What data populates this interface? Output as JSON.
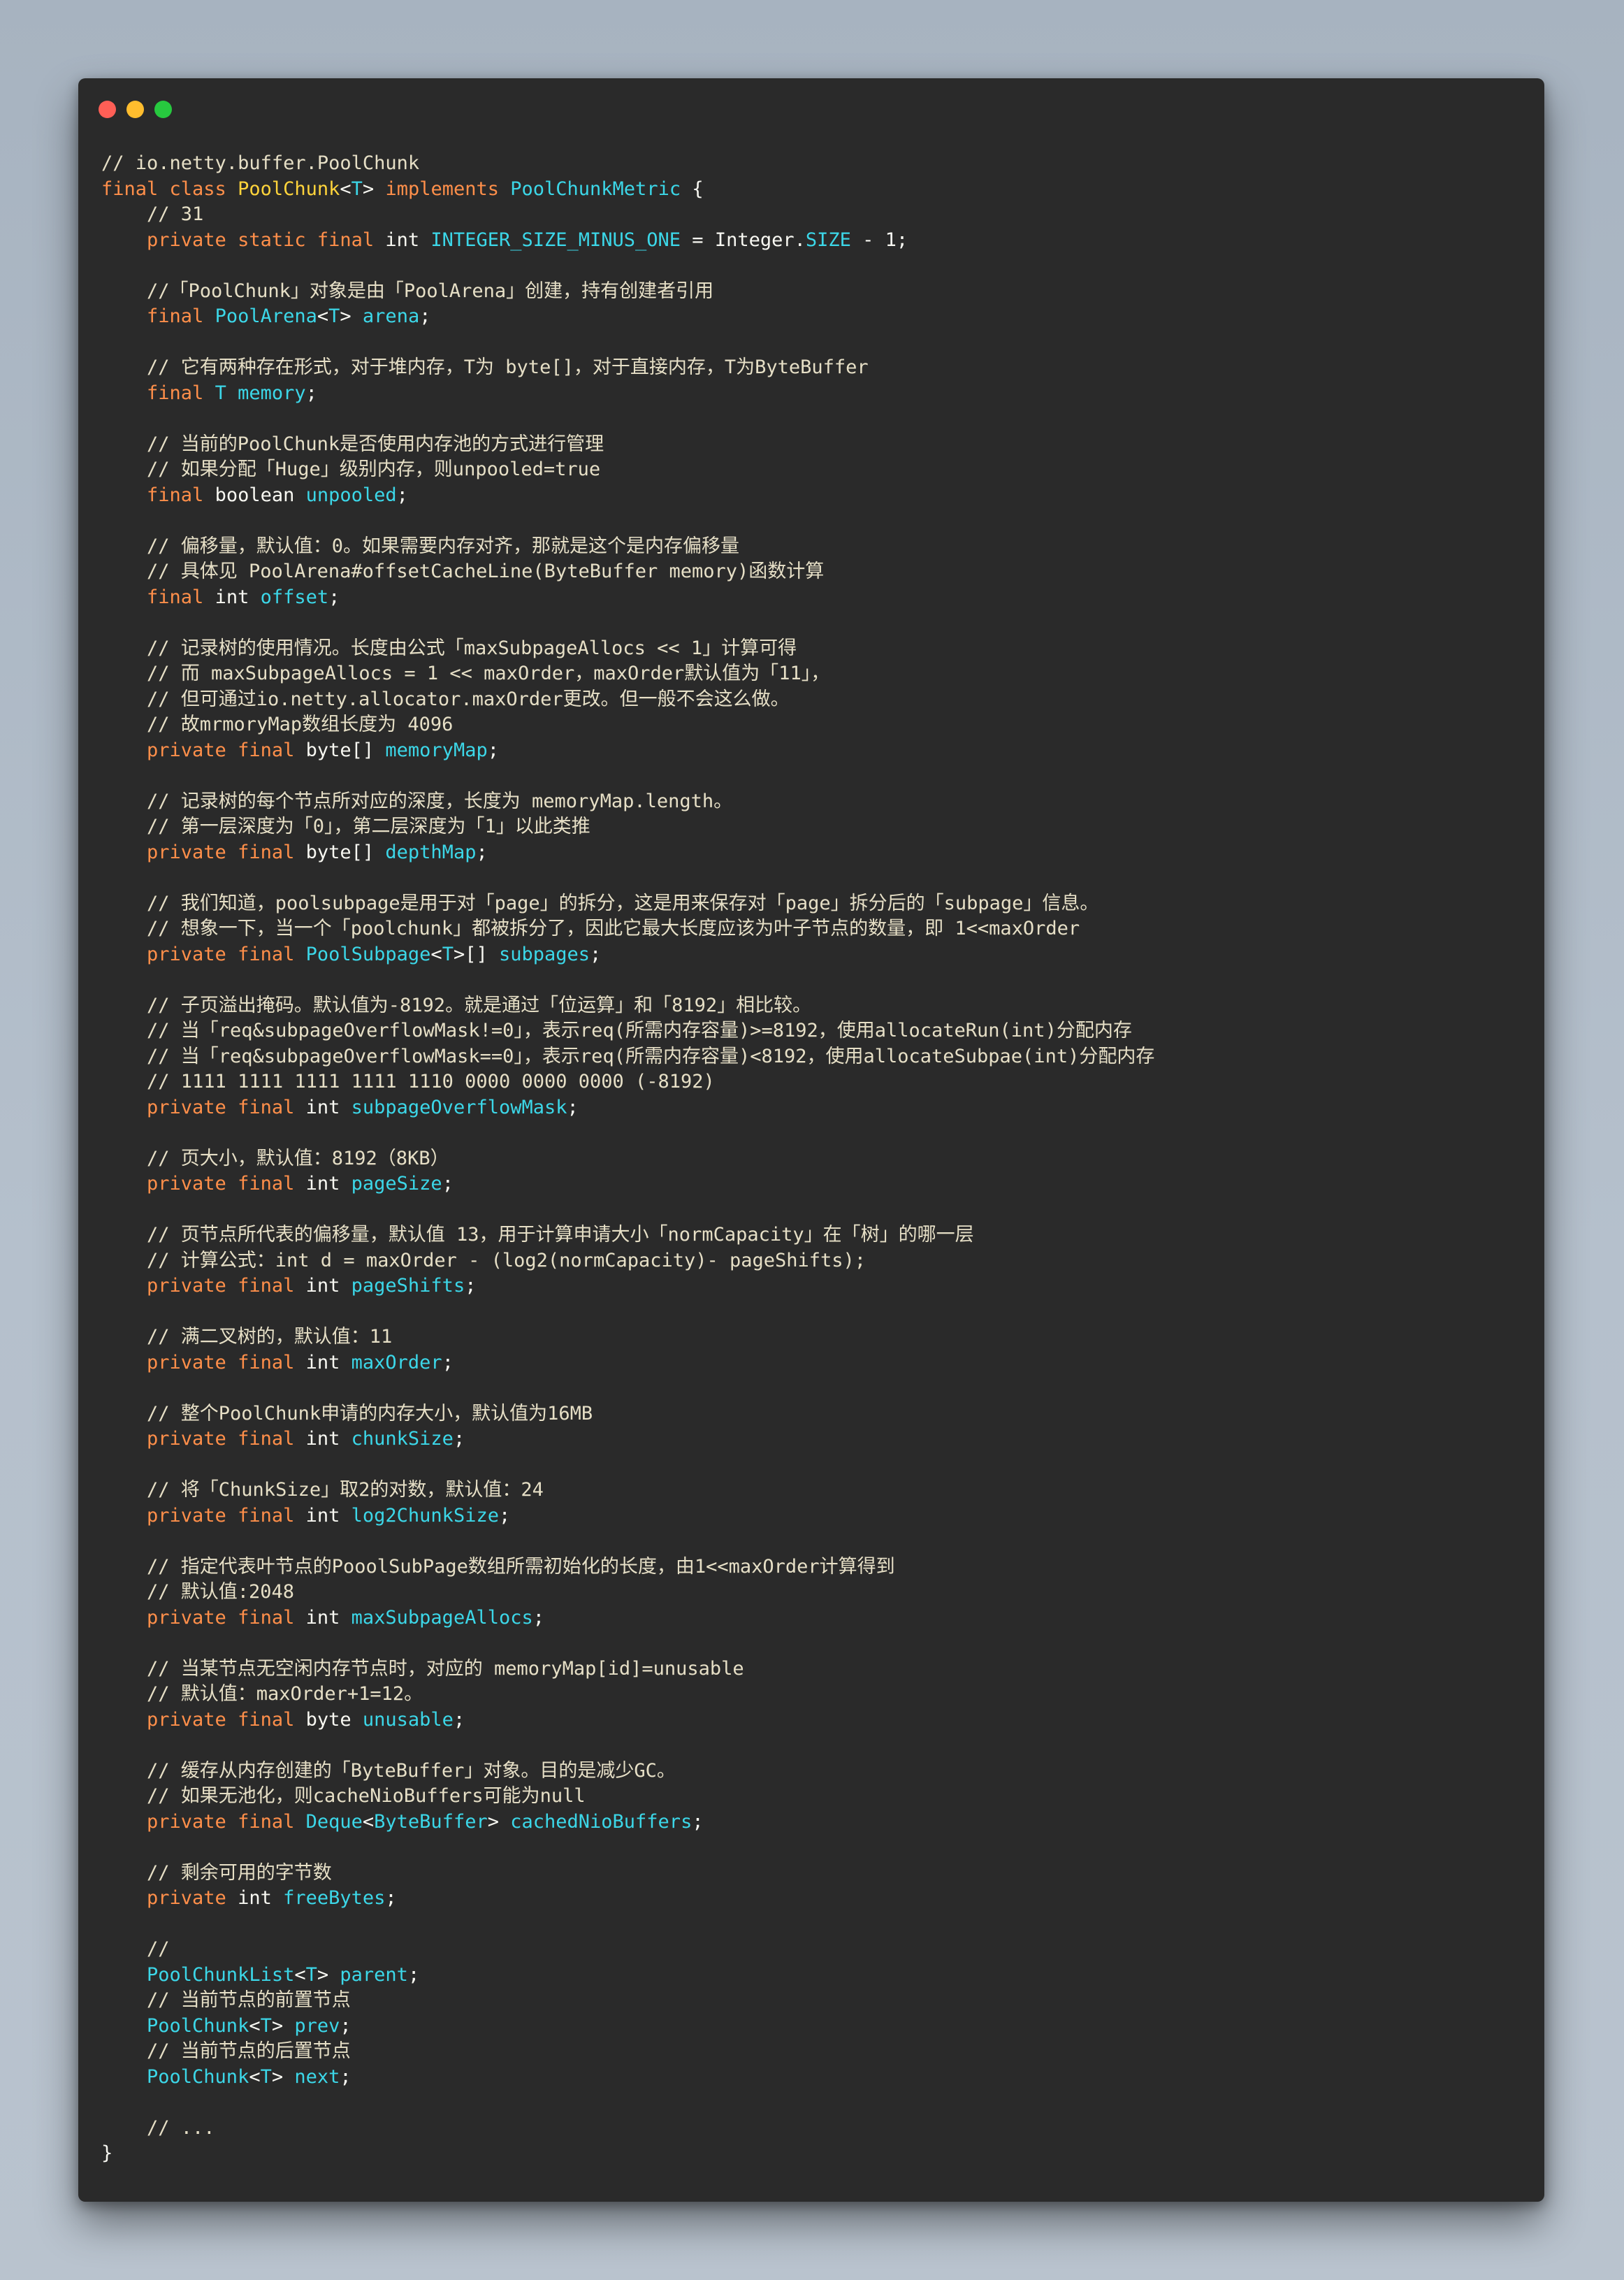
{
  "window": {
    "controls": [
      "close",
      "minimize",
      "zoom"
    ]
  },
  "code_lines": [
    [
      [
        "comment",
        "// io.netty.buffer.PoolChunk"
      ]
    ],
    [
      [
        "keyword",
        "final class "
      ],
      [
        "classname",
        "PoolChunk"
      ],
      [
        "punct",
        "<"
      ],
      [
        "type",
        "T"
      ],
      [
        "punct",
        "> "
      ],
      [
        "keyword",
        "implements "
      ],
      [
        "type",
        "PoolChunkMetric"
      ],
      [
        "punct",
        " {"
      ]
    ],
    [
      [
        "comment",
        "    // 31"
      ]
    ],
    [
      [
        "keyword",
        "    private static final "
      ],
      [
        "plain",
        "int "
      ],
      [
        "field",
        "INTEGER_SIZE_MINUS_ONE"
      ],
      [
        "plain",
        " = Integer."
      ],
      [
        "field",
        "SIZE"
      ],
      [
        "plain",
        " - 1;"
      ]
    ],
    [],
    [
      [
        "comment",
        "    //「PoolChunk」对象是由「PoolArena」创建，持有创建者引用"
      ]
    ],
    [
      [
        "keyword",
        "    final "
      ],
      [
        "type",
        "PoolArena"
      ],
      [
        "punct",
        "<"
      ],
      [
        "type",
        "T"
      ],
      [
        "punct",
        "> "
      ],
      [
        "field",
        "arena"
      ],
      [
        "punct",
        ";"
      ]
    ],
    [],
    [
      [
        "comment",
        "    // 它有两种存在形式，对于堆内存，T为 byte[]，对于直接内存，T为ByteBuffer"
      ]
    ],
    [
      [
        "keyword",
        "    final "
      ],
      [
        "type",
        "T "
      ],
      [
        "field",
        "memory"
      ],
      [
        "punct",
        ";"
      ]
    ],
    [],
    [
      [
        "comment",
        "    // 当前的PoolChunk是否使用内存池的方式进行管理"
      ]
    ],
    [
      [
        "comment",
        "    // 如果分配「Huge」级别内存，则unpooled=true"
      ]
    ],
    [
      [
        "keyword",
        "    final "
      ],
      [
        "plain",
        "boolean "
      ],
      [
        "field",
        "unpooled"
      ],
      [
        "punct",
        ";"
      ]
    ],
    [],
    [
      [
        "comment",
        "    // 偏移量，默认值：0。如果需要内存对齐，那就是这个是内存偏移量"
      ]
    ],
    [
      [
        "comment",
        "    // 具体见 PoolArena#offsetCacheLine(ByteBuffer memory)函数计算"
      ]
    ],
    [
      [
        "keyword",
        "    final "
      ],
      [
        "plain",
        "int "
      ],
      [
        "field",
        "offset"
      ],
      [
        "punct",
        ";"
      ]
    ],
    [],
    [
      [
        "comment",
        "    // 记录树的使用情况。长度由公式「maxSubpageAllocs << 1」计算可得"
      ]
    ],
    [
      [
        "comment",
        "    // 而 maxSubpageAllocs = 1 << maxOrder，maxOrder默认值为「11」，"
      ]
    ],
    [
      [
        "comment",
        "    // 但可通过io.netty.allocator.maxOrder更改。但一般不会这么做。"
      ]
    ],
    [
      [
        "comment",
        "    // 故mrmoryMap数组长度为 4096"
      ]
    ],
    [
      [
        "keyword",
        "    private final "
      ],
      [
        "plain",
        "byte[] "
      ],
      [
        "field",
        "memoryMap"
      ],
      [
        "punct",
        ";"
      ]
    ],
    [],
    [
      [
        "comment",
        "    // 记录树的每个节点所对应的深度，长度为 memoryMap.length。"
      ]
    ],
    [
      [
        "comment",
        "    // 第一层深度为「0」，第二层深度为「1」以此类推"
      ]
    ],
    [
      [
        "keyword",
        "    private final "
      ],
      [
        "plain",
        "byte[] "
      ],
      [
        "field",
        "depthMap"
      ],
      [
        "punct",
        ";"
      ]
    ],
    [],
    [
      [
        "comment",
        "    // 我们知道，poolsubpage是用于对「page」的拆分，这是用来保存对「page」拆分后的「subpage」信息。"
      ]
    ],
    [
      [
        "comment",
        "    // 想象一下，当一个「poolchunk」都被拆分了，因此它最大长度应该为叶子节点的数量，即 1<<maxOrder"
      ]
    ],
    [
      [
        "keyword",
        "    private final "
      ],
      [
        "type",
        "PoolSubpage"
      ],
      [
        "punct",
        "<"
      ],
      [
        "type",
        "T"
      ],
      [
        "punct",
        ">[] "
      ],
      [
        "field",
        "subpages"
      ],
      [
        "punct",
        ";"
      ]
    ],
    [],
    [
      [
        "comment",
        "    // 子页溢出掩码。默认值为-8192。就是通过「位运算」和「8192」相比较。"
      ]
    ],
    [
      [
        "comment",
        "    // 当「req&subpageOverflowMask!=0」，表示req(所需内存容量)>=8192，使用allocateRun(int)分配内存"
      ]
    ],
    [
      [
        "comment",
        "    // 当「req&subpageOverflowMask==0」，表示req(所需内存容量)<8192，使用allocateSubpae(int)分配内存"
      ]
    ],
    [
      [
        "comment",
        "    // 1111 1111 1111 1111 1110 0000 0000 0000 (-8192)"
      ]
    ],
    [
      [
        "keyword",
        "    private final "
      ],
      [
        "plain",
        "int "
      ],
      [
        "field",
        "subpageOverflowMask"
      ],
      [
        "punct",
        ";"
      ]
    ],
    [],
    [
      [
        "comment",
        "    // 页大小，默认值：8192（8KB）"
      ]
    ],
    [
      [
        "keyword",
        "    private final "
      ],
      [
        "plain",
        "int "
      ],
      [
        "field",
        "pageSize"
      ],
      [
        "punct",
        ";"
      ]
    ],
    [],
    [
      [
        "comment",
        "    // 页节点所代表的偏移量，默认值 13，用于计算申请大小「normCapacity」在「树」的哪一层"
      ]
    ],
    [
      [
        "comment",
        "    // 计算公式：int d = maxOrder - (log2(normCapacity)- pageShifts);"
      ]
    ],
    [
      [
        "keyword",
        "    private final "
      ],
      [
        "plain",
        "int "
      ],
      [
        "field",
        "pageShifts"
      ],
      [
        "punct",
        ";"
      ]
    ],
    [],
    [
      [
        "comment",
        "    // 满二叉树的，默认值：11"
      ]
    ],
    [
      [
        "keyword",
        "    private final "
      ],
      [
        "plain",
        "int "
      ],
      [
        "field",
        "maxOrder"
      ],
      [
        "punct",
        ";"
      ]
    ],
    [],
    [
      [
        "comment",
        "    // 整个PoolChunk申请的内存大小，默认值为16MB"
      ]
    ],
    [
      [
        "keyword",
        "    private final "
      ],
      [
        "plain",
        "int "
      ],
      [
        "field",
        "chunkSize"
      ],
      [
        "punct",
        ";"
      ]
    ],
    [],
    [
      [
        "comment",
        "    // 将「ChunkSize」取2的对数，默认值：24"
      ]
    ],
    [
      [
        "keyword",
        "    private final "
      ],
      [
        "plain",
        "int "
      ],
      [
        "field",
        "log2ChunkSize"
      ],
      [
        "punct",
        ";"
      ]
    ],
    [],
    [
      [
        "comment",
        "    // 指定代表叶节点的PooolSubPage数组所需初始化的长度，由1<<maxOrder计算得到"
      ]
    ],
    [
      [
        "comment",
        "    // 默认值:2048"
      ]
    ],
    [
      [
        "keyword",
        "    private final "
      ],
      [
        "plain",
        "int "
      ],
      [
        "field",
        "maxSubpageAllocs"
      ],
      [
        "punct",
        ";"
      ]
    ],
    [],
    [
      [
        "comment",
        "    // 当某节点无空闲内存节点时，对应的 memoryMap[id]=unusable"
      ]
    ],
    [
      [
        "comment",
        "    // 默认值：maxOrder+1=12。"
      ]
    ],
    [
      [
        "keyword",
        "    private final "
      ],
      [
        "plain",
        "byte "
      ],
      [
        "field",
        "unusable"
      ],
      [
        "punct",
        ";"
      ]
    ],
    [],
    [
      [
        "comment",
        "    // 缓存从内存创建的「ByteBuffer」对象。目的是减少GC。"
      ]
    ],
    [
      [
        "comment",
        "    // 如果无池化，则cacheNioBuffers可能为null"
      ]
    ],
    [
      [
        "keyword",
        "    private final "
      ],
      [
        "type",
        "Deque"
      ],
      [
        "punct",
        "<"
      ],
      [
        "type",
        "ByteBuffer"
      ],
      [
        "punct",
        "> "
      ],
      [
        "field",
        "cachedNioBuffers"
      ],
      [
        "punct",
        ";"
      ]
    ],
    [],
    [
      [
        "comment",
        "    // 剩余可用的字节数"
      ]
    ],
    [
      [
        "keyword",
        "    private "
      ],
      [
        "plain",
        "int "
      ],
      [
        "field",
        "freeBytes"
      ],
      [
        "punct",
        ";"
      ]
    ],
    [],
    [
      [
        "comment",
        "    //"
      ]
    ],
    [
      [
        "type",
        "    PoolChunkList"
      ],
      [
        "punct",
        "<"
      ],
      [
        "type",
        "T"
      ],
      [
        "punct",
        "> "
      ],
      [
        "field",
        "parent"
      ],
      [
        "punct",
        ";"
      ]
    ],
    [
      [
        "comment",
        "    // 当前节点的前置节点"
      ]
    ],
    [
      [
        "type",
        "    PoolChunk"
      ],
      [
        "punct",
        "<"
      ],
      [
        "type",
        "T"
      ],
      [
        "punct",
        "> "
      ],
      [
        "field",
        "prev"
      ],
      [
        "punct",
        ";"
      ]
    ],
    [
      [
        "comment",
        "    // 当前节点的后置节点"
      ]
    ],
    [
      [
        "type",
        "    PoolChunk"
      ],
      [
        "punct",
        "<"
      ],
      [
        "type",
        "T"
      ],
      [
        "punct",
        "> "
      ],
      [
        "field",
        "next"
      ],
      [
        "punct",
        ";"
      ]
    ],
    [],
    [
      [
        "comment",
        "    // ..."
      ]
    ],
    [
      [
        "punct",
        "}"
      ]
    ]
  ]
}
